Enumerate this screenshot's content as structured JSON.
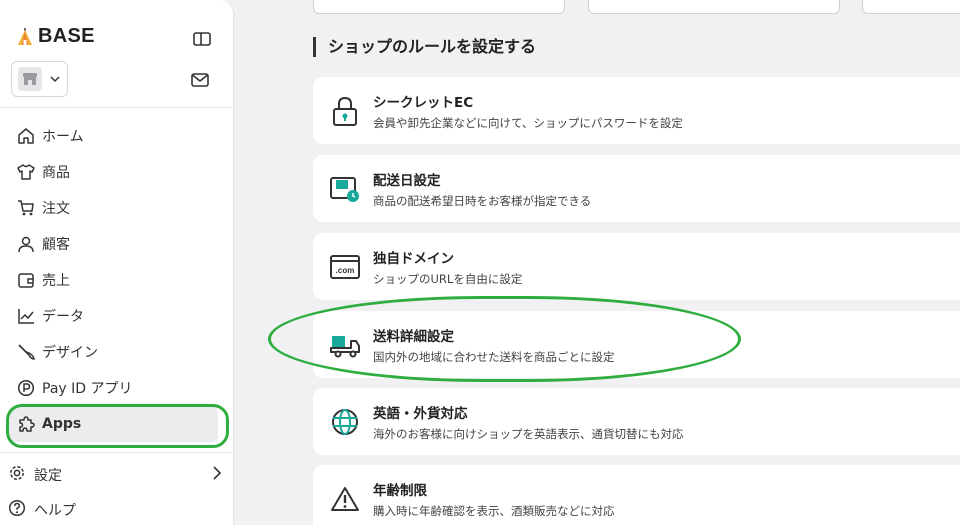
{
  "brand": {
    "name": "BASE"
  },
  "sidebar": {
    "items": [
      {
        "label": "ホーム",
        "icon": "home-icon"
      },
      {
        "label": "商品",
        "icon": "shirt-icon"
      },
      {
        "label": "注文",
        "icon": "cart-icon"
      },
      {
        "label": "顧客",
        "icon": "user-icon"
      },
      {
        "label": "売上",
        "icon": "wallet-icon"
      },
      {
        "label": "データ",
        "icon": "chart-icon"
      },
      {
        "label": "デザイン",
        "icon": "brush-icon"
      },
      {
        "label": "Pay ID アプリ",
        "icon": "payid-icon"
      },
      {
        "label": "Apps",
        "icon": "puzzle-icon",
        "active": true
      }
    ],
    "settings_label": "設定",
    "help_label": "ヘルプ"
  },
  "main": {
    "section_title": "ショップのルールを設定する",
    "cards": [
      {
        "title": "シークレットEC",
        "desc": "会員や卸先企業などに向けて、ショップにパスワードを設定",
        "icon": "lock-icon"
      },
      {
        "title": "配送日設定",
        "desc": "商品の配送希望日時をお客様が指定できる",
        "icon": "delivery-date-icon"
      },
      {
        "title": "独自ドメイン",
        "desc": "ショップのURLを自由に設定",
        "icon": "domain-icon",
        "icon_text": ".com"
      },
      {
        "title": "送料詳細設定",
        "desc": "国内外の地域に合わせた送料を商品ごとに設定",
        "icon": "truck-icon"
      },
      {
        "title": "英語・外貨対応",
        "desc": "海外のお客様に向けショップを英語表示、通貨切替にも対応",
        "icon": "globe-icon"
      },
      {
        "title": "年齢制限",
        "desc": "購入時に年齢確認を表示、酒類販売などに対応",
        "icon": "warning-icon"
      }
    ]
  },
  "colors": {
    "accent": "#2fad3f",
    "teal": "#18a99b",
    "background": "#f1f1f3"
  }
}
